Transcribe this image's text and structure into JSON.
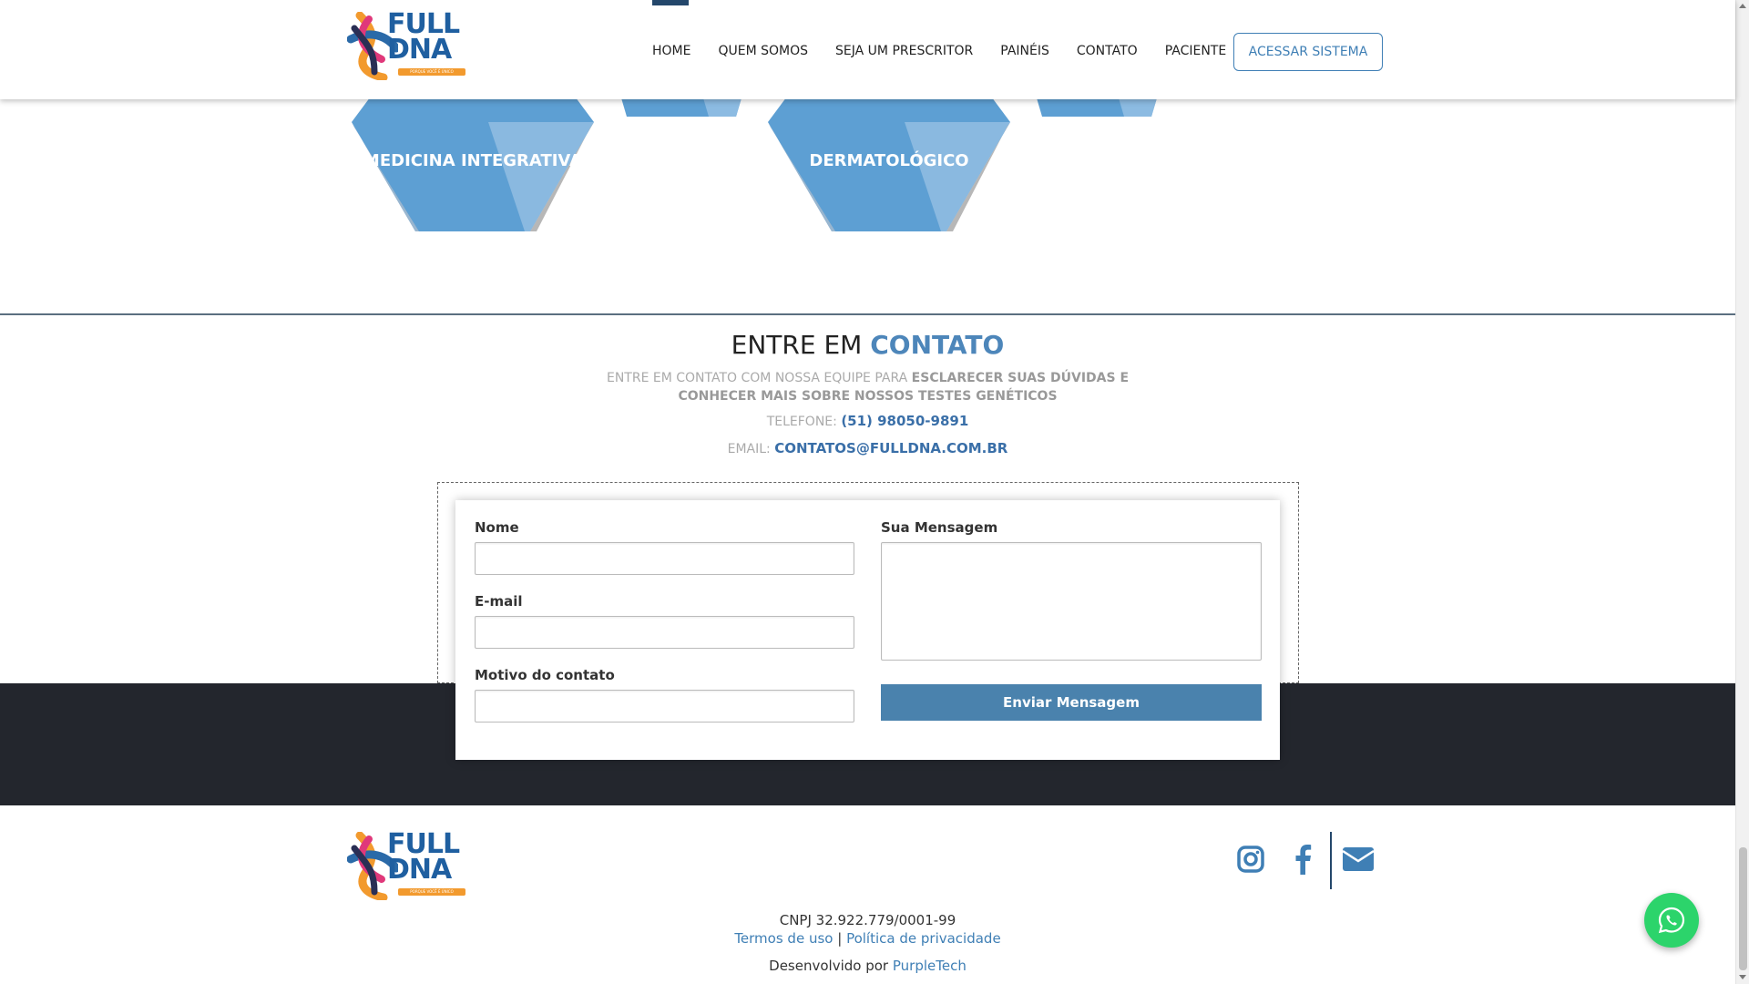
{
  "brand": {
    "logo_top": "FULL",
    "logo_bottom": "DNA",
    "tagline": "PORQUE VOCÊ É ÚNICO",
    "primary_color": "#3f7fb5",
    "dark_color": "#23262d",
    "accent_orange": "#f29a2e"
  },
  "nav": {
    "items": [
      {
        "label": "HOME",
        "active": true
      },
      {
        "label": "QUEM SOMOS"
      },
      {
        "label": "SEJA UM PRESCRITOR"
      },
      {
        "label": "PAINÉIS"
      },
      {
        "label": "CONTATO"
      },
      {
        "label": "PACIENTE"
      }
    ],
    "cta_label": "ACESSAR SISTEMA"
  },
  "panels": {
    "hex_1_label": "MEDICINA INTEGRATIVA",
    "hex_2_label": "DERMATOLÓGICO",
    "hex_color": "#5d9fd3"
  },
  "contact": {
    "title_plain": "ENTRE EM",
    "title_accent": "CONTATO",
    "desc_plain": "ENTRE EM CONTATO COM NOSSA EQUIPE PARA",
    "desc_bold": "ESCLARECER SUAS DÚVIDAS E CONHECER MAIS SOBRE NOSSOS TESTES GENÉTICOS",
    "phone_label": "TELEFONE:",
    "phone_value": "(51) 98050-9891",
    "email_label": "EMAIL:",
    "email_value": "CONTATOS@FULLDNA.COM.BR"
  },
  "form": {
    "name_label": "Nome",
    "email_label": "E-mail",
    "reason_label": "Motivo do contato",
    "message_label": "Sua Mensagem",
    "name_value": "",
    "email_value": "",
    "reason_value": "",
    "message_value": "",
    "submit_label": "Enviar Mensagem"
  },
  "footer": {
    "social_icons": [
      "instagram-icon",
      "facebook-icon",
      "envelope-icon"
    ],
    "cnpj": "CNPJ 32.922.779/0001-99",
    "terms_label": "Termos de uso",
    "separator": "|",
    "privacy_label": "Política de privacidade",
    "dev_prefix": "Desenvolvido por",
    "dev_name": "PurpleTech",
    "whatsapp_icon": "whatsapp-icon"
  }
}
